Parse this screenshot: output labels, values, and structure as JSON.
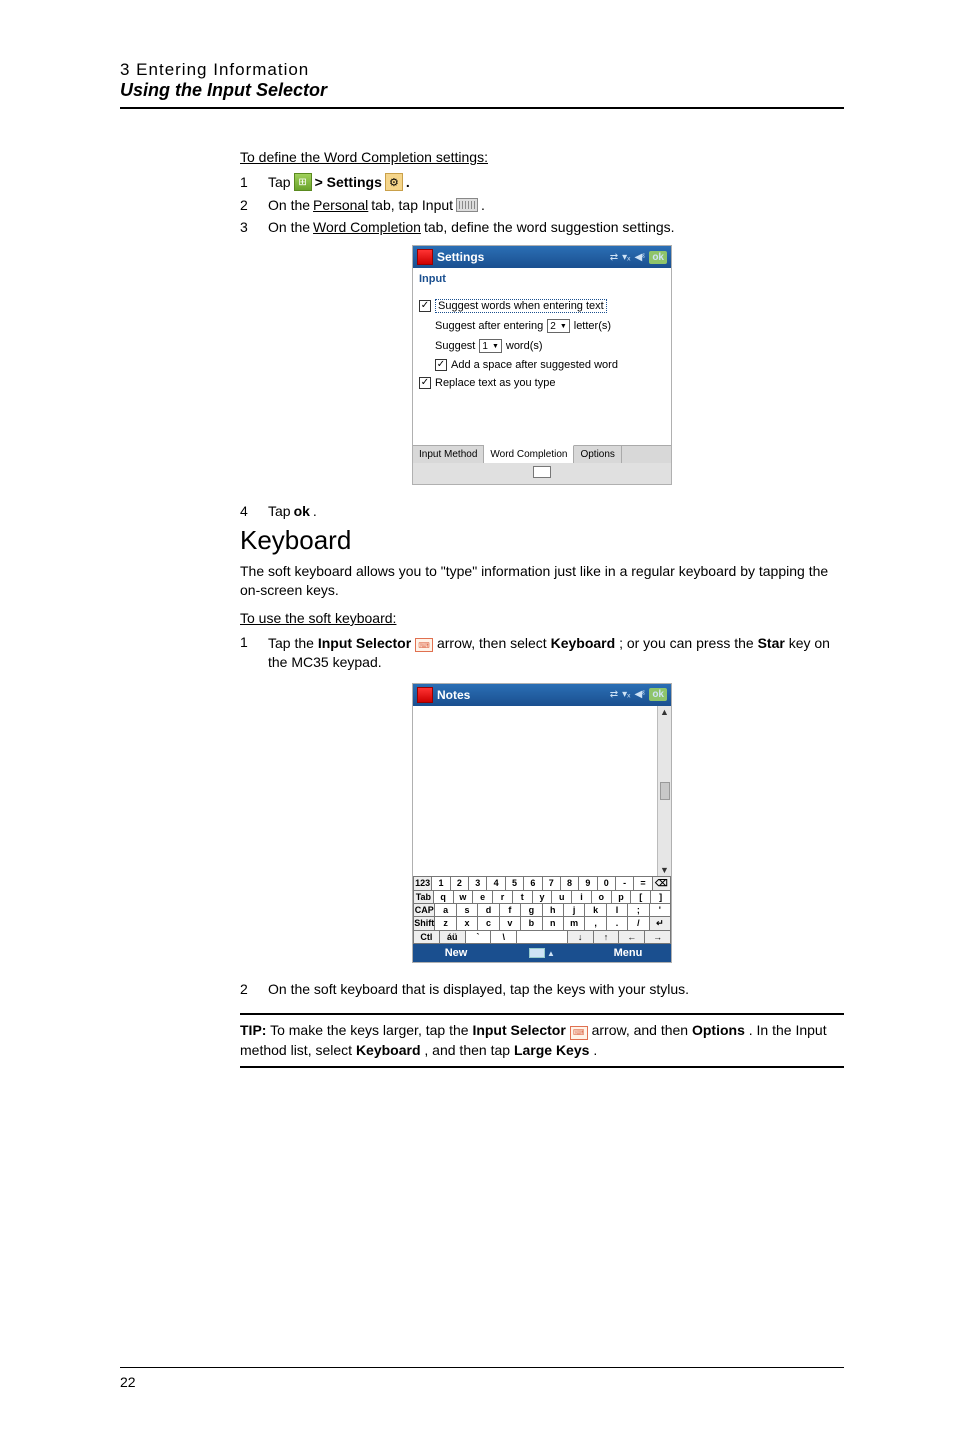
{
  "header": {
    "chapter": "3 Entering Information",
    "subtitle": "Using the Input Selector"
  },
  "proc1": {
    "title": "To define the Word Completion settings:",
    "steps": {
      "s1": {
        "num": "1",
        "pre": "Tap",
        "mid": " > Settings",
        "post": "."
      },
      "s2": {
        "num": "2",
        "pre": "On the ",
        "tab": "Personal",
        "mid": " tab, tap Input ",
        "post": "."
      },
      "s3": {
        "num": "3",
        "pre": "On the ",
        "tab": "Word Completion",
        "post": " tab, define the word suggestion settings."
      },
      "s4": {
        "num": "4",
        "pre": "Tap ",
        "ok": "ok",
        "post": "."
      }
    }
  },
  "settings_shot": {
    "title": "Settings",
    "sub": "Input",
    "ok": "ok",
    "cb1": "Suggest words when entering text",
    "row2_pre": "Suggest after entering",
    "row2_sel": "2",
    "row2_post": "letter(s)",
    "row3_pre": "Suggest",
    "row3_sel": "1",
    "row3_post": "word(s)",
    "cb4": "Add a space after suggested word",
    "cb5": "Replace text as you type",
    "tabs": {
      "a": "Input Method",
      "b": "Word Completion",
      "c": "Options"
    }
  },
  "keyboard_section": {
    "heading": "Keyboard",
    "intro": "The soft keyboard allows you to \"type\" information just like in a regular keyboard by tapping the on-screen keys.",
    "proc_title": "To use the soft keyboard:",
    "step1": {
      "num": "1",
      "a": "Tap the ",
      "is": "Input Selector",
      "b": " arrow, then select ",
      "kb": "Keyboard",
      "c": "; or you can press the ",
      "star": "Star",
      "d": " key on the MC35 keypad."
    },
    "step2": {
      "num": "2",
      "text": "On the soft keyboard that is displayed, tap the keys with your stylus."
    }
  },
  "notes_shot": {
    "title": "Notes",
    "ok": "ok",
    "rows": {
      "r1": [
        "123",
        "1",
        "2",
        "3",
        "4",
        "5",
        "6",
        "7",
        "8",
        "9",
        "0",
        "-",
        "=",
        "⌫"
      ],
      "r2": [
        "Tab",
        "q",
        "w",
        "e",
        "r",
        "t",
        "y",
        "u",
        "i",
        "o",
        "p",
        "[",
        "]"
      ],
      "r3": [
        "CAP",
        "a",
        "s",
        "d",
        "f",
        "g",
        "h",
        "j",
        "k",
        "l",
        ";",
        "'"
      ],
      "r4": [
        "Shift",
        "z",
        "x",
        "c",
        "v",
        "b",
        "n",
        "m",
        ",",
        ".",
        "/",
        "↵"
      ],
      "r5": [
        "Ctl",
        "áü",
        "`",
        "\\",
        " ",
        "↓",
        "↑",
        "←",
        "→"
      ]
    },
    "bottom": {
      "new": "New",
      "menu": "Menu"
    }
  },
  "tip": {
    "label": "TIP:",
    "a": "   To make the keys larger, tap the ",
    "is": "Input Selector",
    "b": " arrow, and then ",
    "opt": "Options",
    "c": ". In the Input method list, select ",
    "kb": "Keyboard",
    "d": ", and then tap ",
    "lk": "Large Keys",
    "e": "."
  },
  "pagenum": "22"
}
